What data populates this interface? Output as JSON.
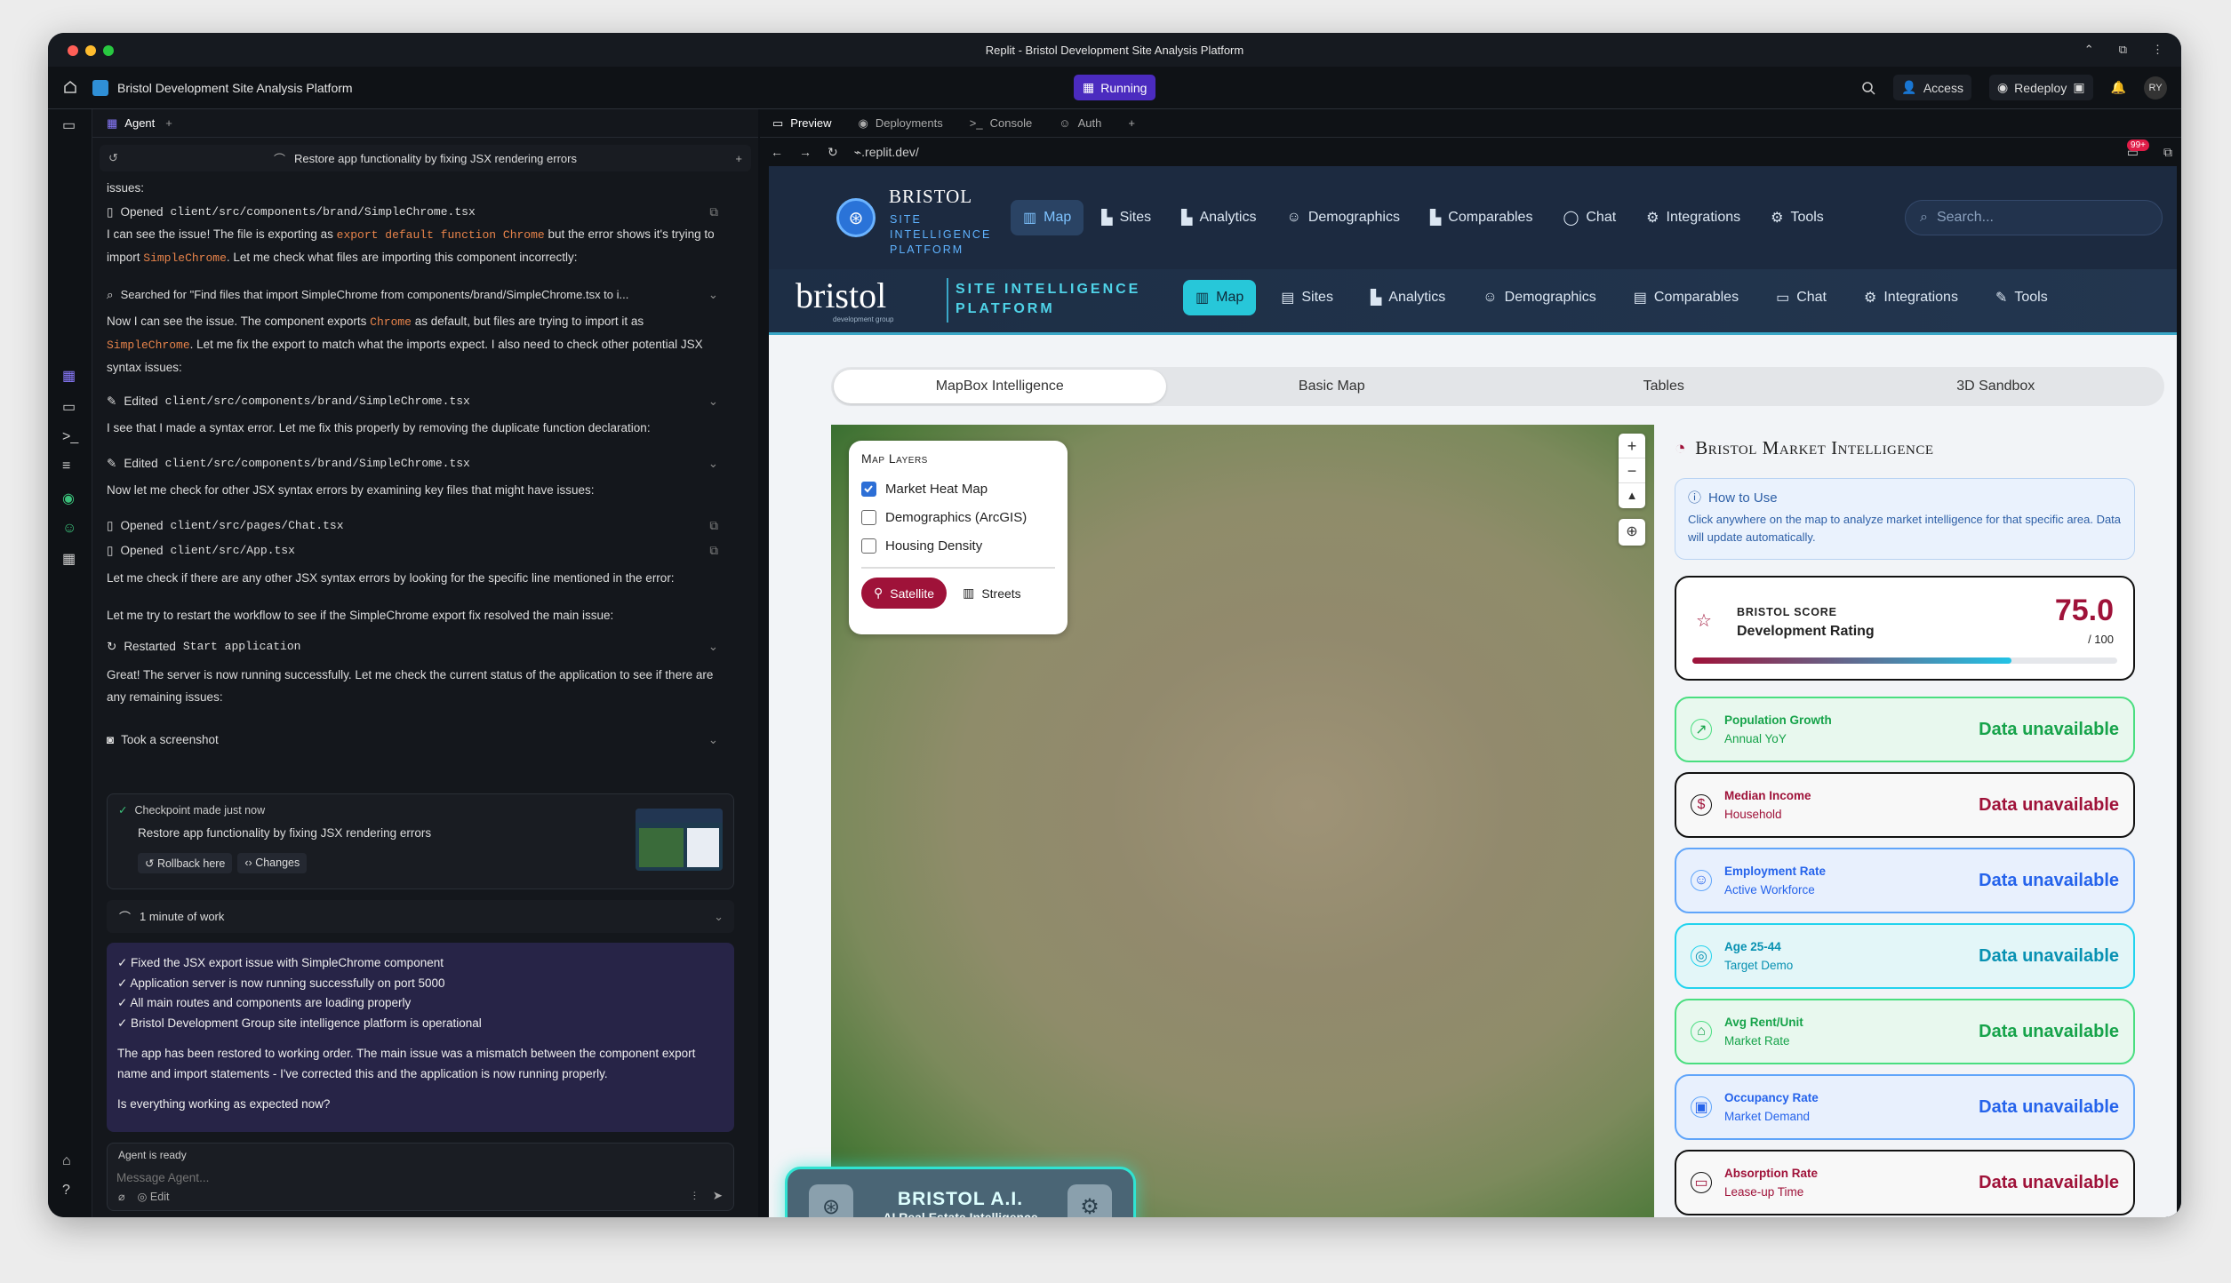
{
  "window": {
    "title": "Replit - Bristol Development Site Analysis Platform"
  },
  "appbar": {
    "project": "Bristol Development Site Analysis Platform",
    "status": "Running",
    "access": "Access",
    "redeploy": "Redeploy",
    "avatar": "RY"
  },
  "agent": {
    "tab": "Agent",
    "thread_title": "Restore app functionality by fixing JSX rendering errors",
    "m0": "issues:",
    "m1_file": "client/src/components/brand/SimpleChrome.tsx",
    "m1_verb": "Opened",
    "m2_a": "I can see the issue! The file is exporting as ",
    "m2_code1": "export default function Chrome",
    "m2_b": " but the error shows it's trying to import ",
    "m2_code2": "SimpleChrome",
    "m2_c": ". Let me check what files are importing this component incorrectly:",
    "m3": "Searched for \"Find files that import SimpleChrome from components/brand/SimpleChrome.tsx to i...",
    "m4_a": "Now I can see the issue. The component exports ",
    "m4_code1": "Chrome",
    "m4_b": " as default, but files are trying to import it as ",
    "m4_code2": "SimpleChrome",
    "m4_c": ". Let me fix the export to match what the imports expect. I also need to check other potential JSX syntax issues:",
    "m5_verb": "Edited",
    "m5_file": "client/src/components/brand/SimpleChrome.tsx",
    "m6": "I see that I made a syntax error. Let me fix this properly by removing the duplicate function declaration:",
    "m7_verb": "Edited",
    "m7_file": "client/src/components/brand/SimpleChrome.tsx",
    "m8": "Now let me check for other JSX syntax errors by examining key files that might have issues:",
    "m9_verb": "Opened",
    "m9_file": "client/src/pages/Chat.tsx",
    "m10_verb": "Opened",
    "m10_file": "client/src/App.tsx",
    "m11": "Let me check if there are any other JSX syntax errors by looking for the specific line mentioned in the error:",
    "m12": "Let me try to restart the workflow to see if the SimpleChrome export fix resolved the main issue:",
    "m13_verb": "Restarted",
    "m13_name": "Start application",
    "m14": "Great! The server is now running successfully. Let me check the current status of the application to see if there are any remaining issues:",
    "m15": "Took a screenshot",
    "checkpoint": {
      "label": "Checkpoint made just now",
      "title": "Restore app functionality by fixing JSX rendering errors",
      "rollback": "Rollback here",
      "changes": "Changes"
    },
    "work": "1 minute of work",
    "summary": {
      "items": [
        "✓ Fixed the JSX export issue with SimpleChrome component",
        "✓ Application server is now running successfully on port 5000",
        "✓ All main routes and components are loading properly",
        "✓ Bristol Development Group site intelligence platform is operational"
      ],
      "p1": "The app has been restored to working order. The main issue was a mismatch between the component export name and import statements - I've corrected this and the application is now running properly.",
      "p2": "Is everything working as expected now?"
    },
    "status": "Agent is ready",
    "placeholder": "Message Agent...",
    "edit": "Edit"
  },
  "preview": {
    "tabs": [
      "Preview",
      "Deployments",
      "Console",
      "Auth"
    ],
    "url": ".replit.dev/",
    "badge": "99+"
  },
  "site": {
    "brand1": "BRISTOL",
    "brand1_sub": [
      "SITE",
      "INTELLIGENCE",
      "PLATFORM"
    ],
    "nav": [
      "Map",
      "Sites",
      "Analytics",
      "Demographics",
      "Comparables",
      "Chat",
      "Integrations",
      "Tools"
    ],
    "search": "Search...",
    "brand2": "bristol",
    "brand2_sub": "development group",
    "brand2_tag1": "SITE INTELLIGENCE",
    "brand2_tag2": "PLATFORM",
    "segments": [
      "MapBox Intelligence",
      "Basic Map",
      "Tables",
      "3D Sandbox"
    ],
    "layers": {
      "title": "Map Layers",
      "items": [
        "Market Heat Map",
        "Demographics (ArcGIS)",
        "Housing Density"
      ],
      "checked": [
        true,
        false,
        false
      ],
      "satellite": "Satellite",
      "streets": "Streets"
    },
    "ai": {
      "title": "BRISTOL A.I.",
      "sub": "AI Real Estate Intelligence"
    },
    "panel": {
      "title": "Bristol Market Intelligence",
      "howto_title": "How to Use",
      "howto_body": "Click anywhere on the map to analyze market intelligence for that specific area. Data will update automatically.",
      "score_label": "BRISTOL SCORE",
      "score_sub": "Development Rating",
      "score": "75.0",
      "score_max": "/ 100",
      "score_fraction": 0.75,
      "stats": [
        {
          "label": "Population Growth",
          "sub": "Annual YoY",
          "value": "Data unavailable",
          "color": "#16a34a",
          "bg": "#e8f8ee",
          "border": "#4ade80"
        },
        {
          "label": "Median Income",
          "sub": "Household",
          "value": "Data unavailable",
          "color": "#9f1239",
          "bg": "#f8f8f8",
          "border": "#111111"
        },
        {
          "label": "Employment Rate",
          "sub": "Active Workforce",
          "value": "Data unavailable",
          "color": "#2563eb",
          "bg": "#e8f0fd",
          "border": "#60a5fa"
        },
        {
          "label": "Age 25-44",
          "sub": "Target Demo",
          "value": "Data unavailable",
          "color": "#0891b2",
          "bg": "#e3f6f8",
          "border": "#22d3ee"
        },
        {
          "label": "Avg Rent/Unit",
          "sub": "Market Rate",
          "value": "Data unavailable",
          "color": "#16a34a",
          "bg": "#e8f8ee",
          "border": "#4ade80"
        },
        {
          "label": "Occupancy Rate",
          "sub": "Market Demand",
          "value": "Data unavailable",
          "color": "#2563eb",
          "bg": "#e8f0fd",
          "border": "#60a5fa"
        },
        {
          "label": "Absorption Rate",
          "sub": "Lease-up Time",
          "value": "Data unavailable",
          "color": "#9f1239",
          "bg": "#f8f8f8",
          "border": "#111111"
        }
      ]
    }
  }
}
